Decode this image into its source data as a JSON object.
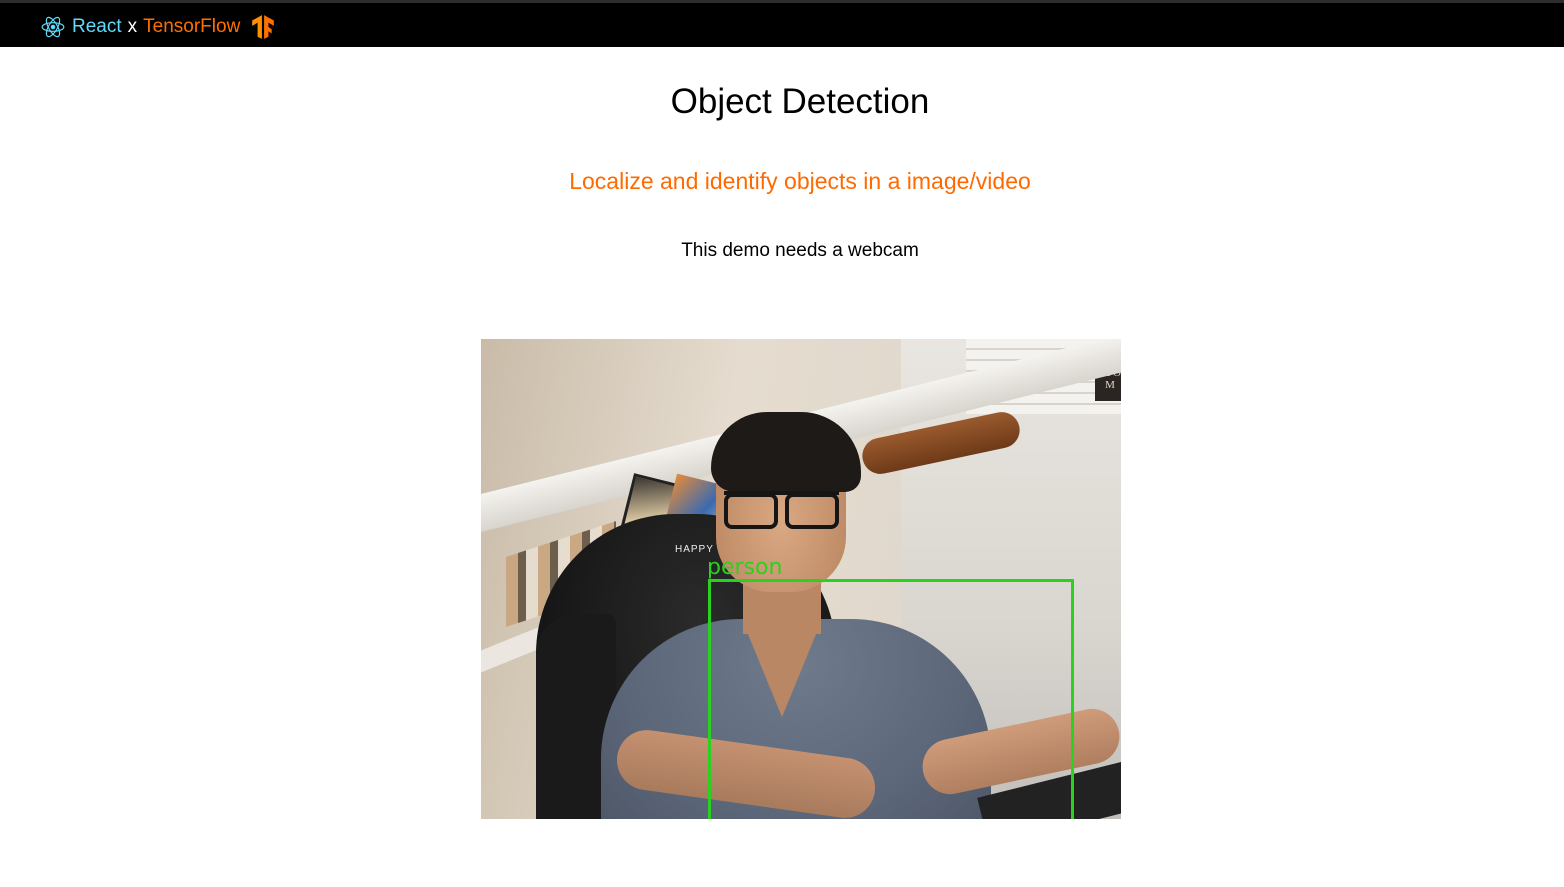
{
  "navbar": {
    "brand_react": "React",
    "brand_separator": "x",
    "brand_tensorflow": "TensorFlow"
  },
  "main": {
    "title": "Object Detection",
    "subtitle": "Localize and identify objects in a image/video",
    "note": "This demo needs a webcam"
  },
  "webcam": {
    "chair_text": "HAPPY",
    "poster_text": "GFO M",
    "detections": [
      {
        "label": "person"
      }
    ]
  },
  "colors": {
    "react": "#61dafb",
    "tensorflow": "#ff6f00",
    "subtitle": "#ff6a00",
    "detection_box": "#2bd11f",
    "navbar_bg": "#000000"
  },
  "icons": {
    "react_logo": "react-logo-icon",
    "tensorflow_logo": "tensorflow-logo-icon"
  }
}
